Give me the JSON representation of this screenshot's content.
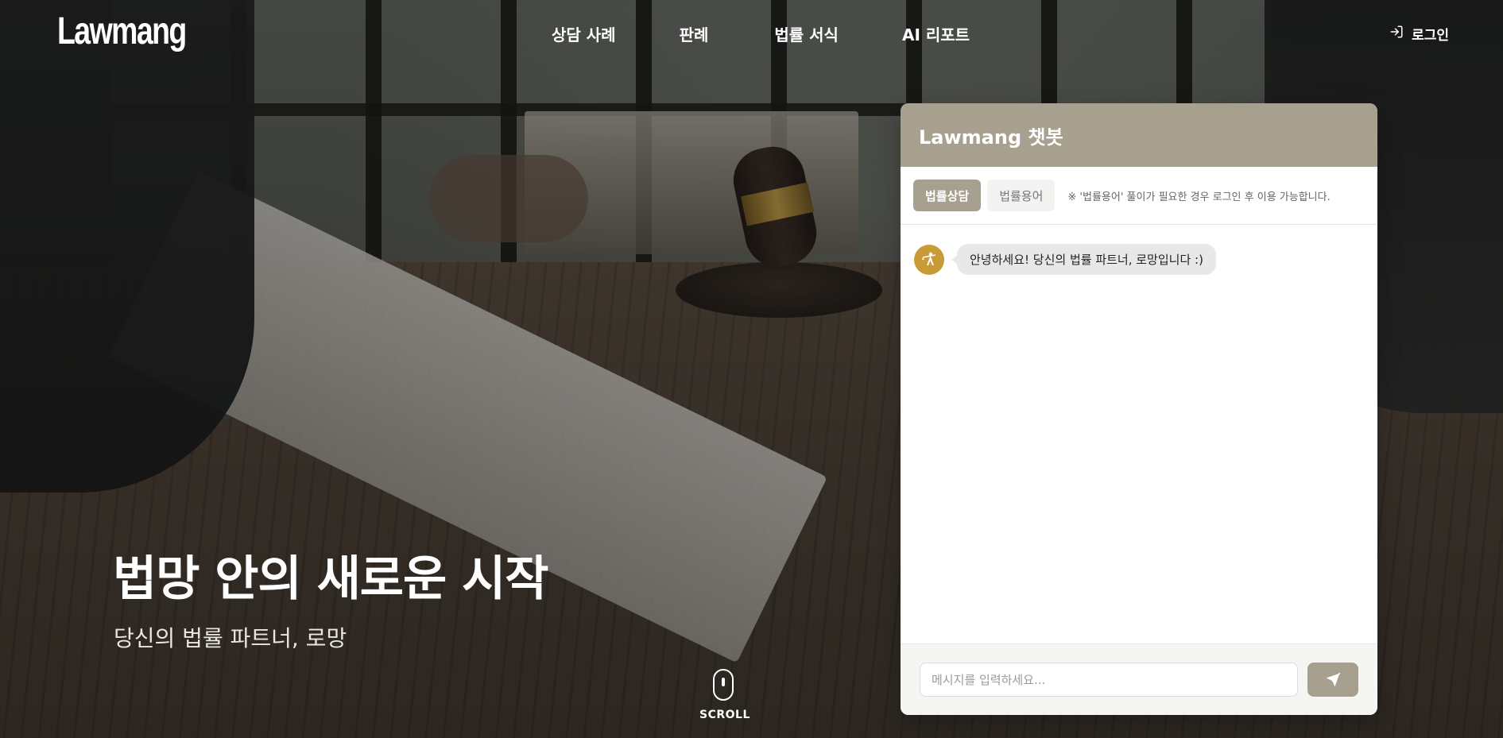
{
  "header": {
    "logo": "Lawmang",
    "nav": [
      "상담 사례",
      "판례",
      "법률 서식",
      "AI 리포트"
    ],
    "login_label": "로그인"
  },
  "hero": {
    "title": "법망 안의 새로운 시작",
    "subtitle": "당신의 법률 파트너, 로망",
    "scroll_label": "SCROLL"
  },
  "chatbot": {
    "title": "Lawmang 챗봇",
    "tabs": [
      {
        "label": "법률상담",
        "active": true
      },
      {
        "label": "법률용어",
        "active": false
      }
    ],
    "tab_note": "※ '법률용어' 풀이가 필요한 경우 로그인 후 이용 가능합니다.",
    "messages": [
      {
        "sender": "bot",
        "text": "안녕하세요! 당신의 법률 파트너, 로망입니다 :)"
      }
    ],
    "input_placeholder": "메시지를 입력하세요...",
    "accent_color": "#a8a08e",
    "avatar_color": "#c99b36"
  }
}
